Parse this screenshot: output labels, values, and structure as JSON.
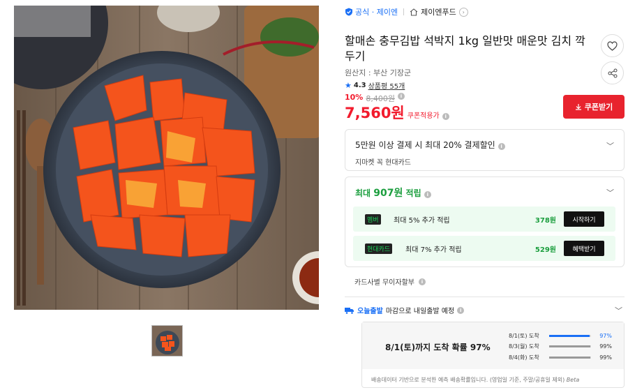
{
  "store": {
    "official": "공식 · 제이엔",
    "seller": "제이엔푸드"
  },
  "product": {
    "title": "할매손 충무김밥 석박지 1kg 일반맛 매운맛 김치 깍두기",
    "origin": "원산지 : 부산 기장군",
    "rating": "4.3",
    "reviews": "상품평 55개",
    "discount_pct": "10%",
    "original_price": "8,400원",
    "price": "7,560원",
    "price_label": "쿠폰적용가"
  },
  "buttons": {
    "coupon": "쿠폰받기",
    "like": "heart-icon",
    "share": "share-icon"
  },
  "card_offer": {
    "title": "5만원 이상 결제 시 최대 20% 결제할인",
    "subtitle": "지마켓 꼭 현대카드"
  },
  "points": {
    "head_prefix": "최대 ",
    "head_amount": "907원",
    "head_suffix": " 적립",
    "rows": [
      {
        "tag": "멤버",
        "text": "최대 5% 추가 적립",
        "amount": "378원",
        "button": "시작하기"
      },
      {
        "tag": "현대카드",
        "text": "최대 7% 추가 적립",
        "amount": "529원",
        "button": "혜택받기"
      }
    ]
  },
  "installment": "카드사별 무이자할부",
  "shipping": {
    "logo": "오늘출발",
    "text": "마감으로 내일출발 예정",
    "main": "8/1(토)까지 도착 확률 97%",
    "rows": [
      {
        "date": "8/1(토) 도착",
        "pct": "97%",
        "value": 0.97
      },
      {
        "date": "8/3(월) 도착",
        "pct": "99%",
        "value": 0.99
      },
      {
        "date": "8/4(화) 도착",
        "pct": "99%",
        "value": 0.99
      }
    ],
    "note": "배송데이터 기반으로 분석한 예측 배송확률입니다. (영업일 기준, 주말/공휴일 제외)",
    "beta": "Beta"
  },
  "colors": {
    "accent": "#1a6ff5",
    "price": "#f21b2d",
    "coupon": "#e8232e",
    "green": "#1b9e3e"
  }
}
